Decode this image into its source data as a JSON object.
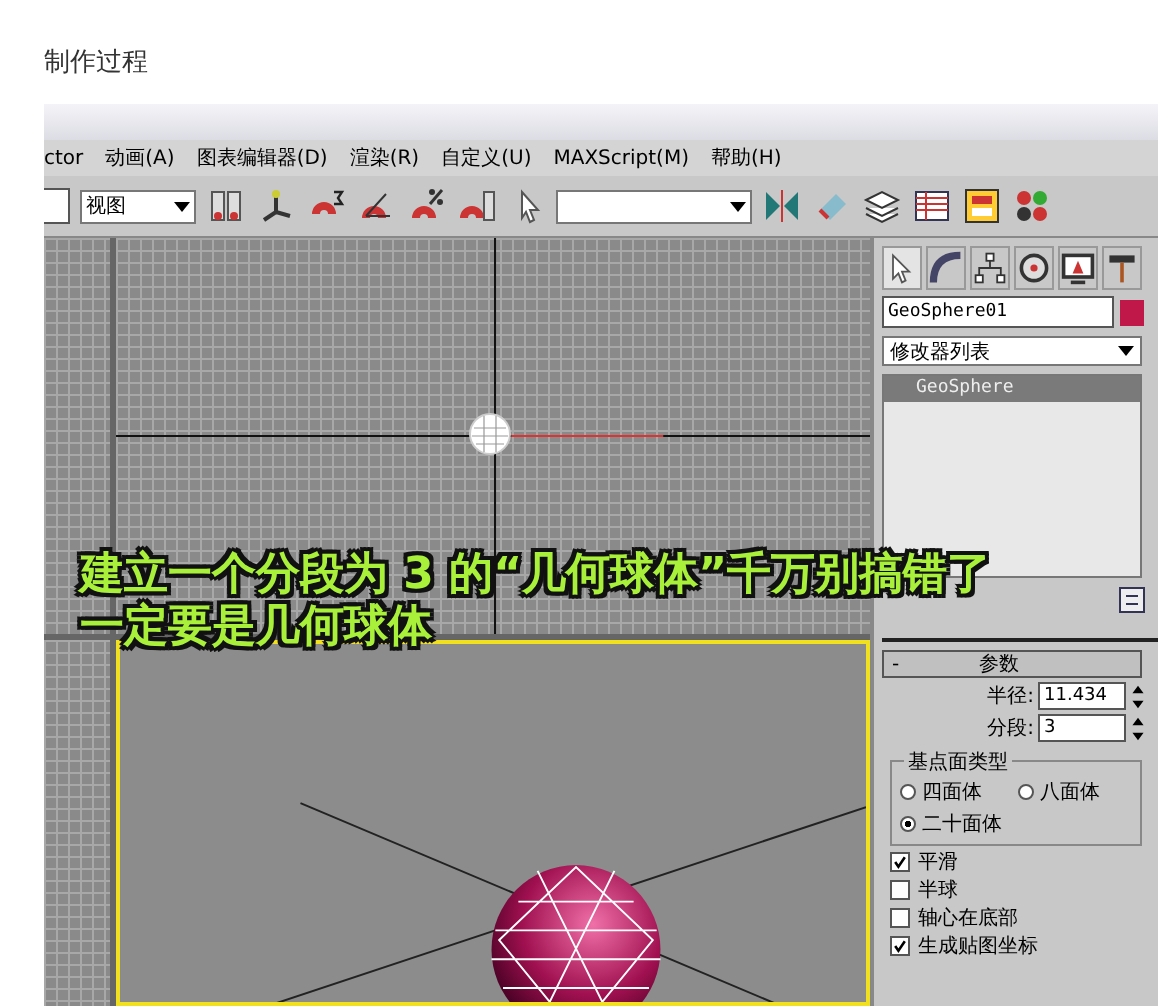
{
  "heading": "制作过程",
  "app": {
    "menu": [
      {
        "label": "ctor"
      },
      {
        "label": "动画(A)"
      },
      {
        "label": "图表编辑器(D)"
      },
      {
        "label": "渲染(R)"
      },
      {
        "label": "自定义(U)"
      },
      {
        "label": "MAXScript(M)"
      },
      {
        "label": "帮助(H)"
      }
    ],
    "toolbar": {
      "view_dropdown": {
        "value": "视图"
      }
    },
    "caption": [
      "建立一个分段为 3 的“几何球体”千万别搞错了",
      "一定要是几何球体"
    ],
    "panel": {
      "object_name": "GeoSphere01",
      "modifier_list": {
        "value": "修改器列表"
      },
      "modifier_stack": [
        {
          "label": "GeoSphere",
          "selected": true
        }
      ],
      "parameters": {
        "collapse": "-",
        "title": "参数",
        "fields": [
          {
            "label": "半径:",
            "value": "11.434"
          },
          {
            "label": "分段:",
            "value": "3"
          }
        ],
        "group": "基点面类型",
        "base_types": [
          {
            "label": "四面体",
            "selected": false
          },
          {
            "label": "八面体",
            "selected": false
          },
          {
            "label": "二十面体",
            "selected": true
          }
        ],
        "options": [
          {
            "label": "平滑",
            "checked": true
          },
          {
            "label": "半球",
            "checked": false
          },
          {
            "label": "轴心在底部",
            "checked": false
          },
          {
            "label": "生成贴图坐标",
            "checked": true
          }
        ]
      }
    }
  }
}
